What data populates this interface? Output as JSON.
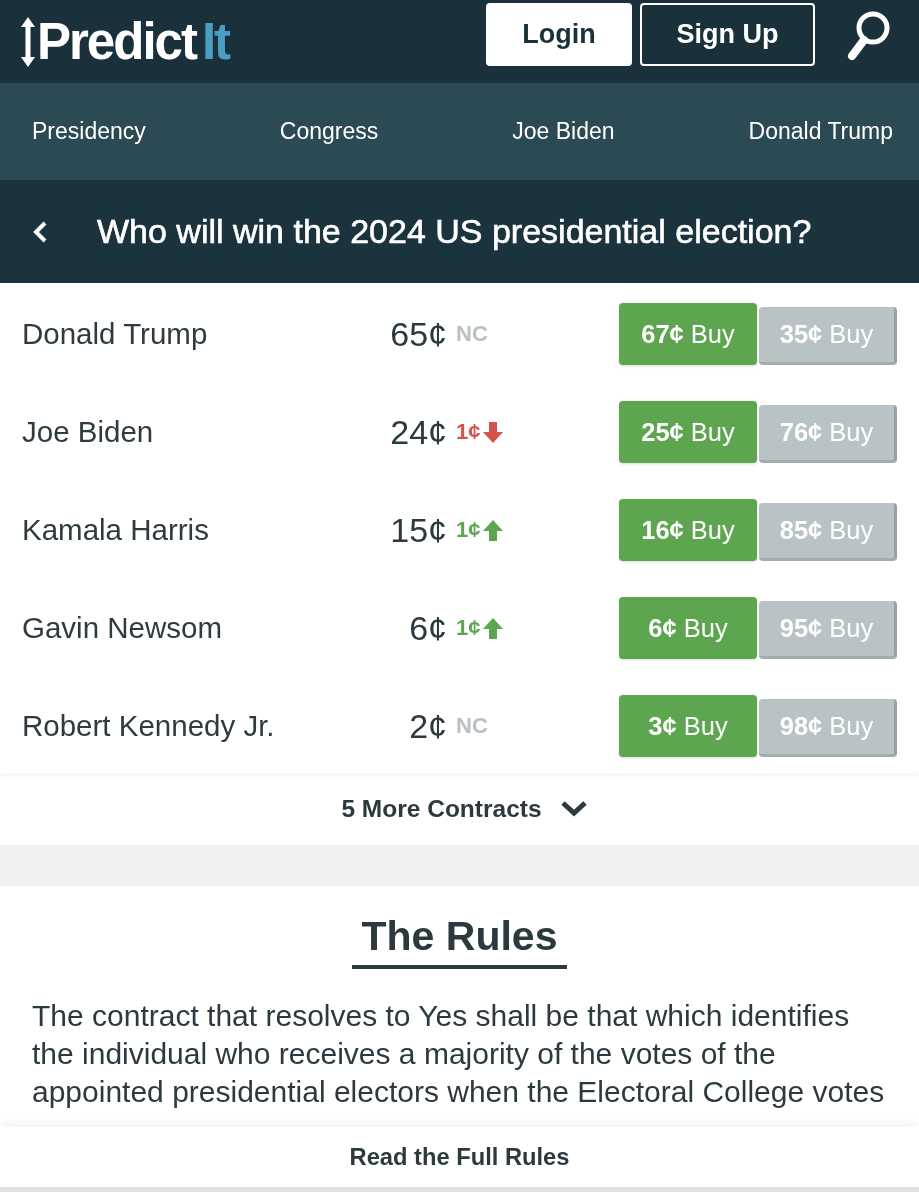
{
  "header": {
    "logo": {
      "text": "Predict",
      "accent": "It"
    },
    "buttons": [
      {
        "label": "Login",
        "kind": "solid"
      },
      {
        "label": "Sign Up",
        "kind": "outline"
      }
    ]
  },
  "nav": {
    "items": [
      "Presidency",
      "Congress",
      "Joe Biden",
      "Donald Trump"
    ]
  },
  "market": {
    "title": "Who will win the 2024 US presidential election?"
  },
  "contracts": [
    {
      "name": "Donald Trump",
      "price": "65¢",
      "change": {
        "kind": "none",
        "text": "NC"
      },
      "yes": "**67¢** Buy",
      "no": "**35¢** Buy"
    },
    {
      "name": "Joe Biden",
      "price": "24¢",
      "change": {
        "kind": "down",
        "text": "1¢"
      },
      "yes": "**25¢** Buy",
      "no": "**76¢** Buy"
    },
    {
      "name": "Kamala Harris",
      "price": "15¢",
      "change": {
        "kind": "up",
        "text": "1¢"
      },
      "yes": "**16¢** Buy",
      "no": "**85¢** Buy"
    },
    {
      "name": "Gavin Newsom",
      "price": "6¢",
      "change": {
        "kind": "up",
        "text": "1¢"
      },
      "yes": "**6¢** Buy",
      "no": "**95¢** Buy"
    },
    {
      "name": "Robert Kennedy Jr.",
      "price": "2¢",
      "change": {
        "kind": "none",
        "text": "NC"
      },
      "yes": "**3¢** Buy",
      "no": "**98¢** Buy"
    }
  ],
  "more": {
    "label": "5 More Contracts"
  },
  "rules": {
    "heading": "The Rules",
    "text": "The contract that resolves to Yes shall be that which identifies the individual who receives a majority of the votes of the appointed presidential electors when the Electoral College votes",
    "link": "Read the Full Rules"
  }
}
